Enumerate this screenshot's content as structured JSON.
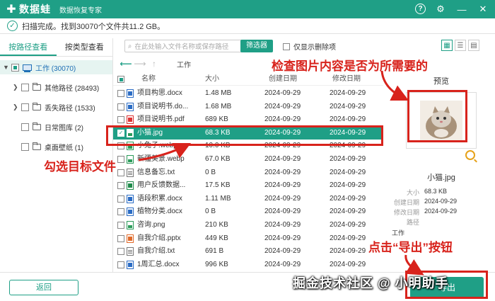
{
  "app": {
    "logo": "数据蛙",
    "subtitle": "数据恢复专家",
    "controls": {
      "help": "?",
      "settings": "⚙",
      "minimize": "—",
      "close": "✕"
    }
  },
  "status": {
    "text": "扫描完成。找到30070个文件共11.2 GB。"
  },
  "left": {
    "tabs": [
      {
        "label": "按路径查看",
        "active": true
      },
      {
        "label": "按类型查看",
        "active": false
      }
    ],
    "tree": [
      {
        "label": "工作 (30070)"
      },
      {
        "label": "其他路径 (28493)"
      },
      {
        "label": "丢失路径 (1533)"
      },
      {
        "label": "日常图库 (2)"
      },
      {
        "label": "桌面壁纸 (1)"
      }
    ]
  },
  "toolbar": {
    "search_placeholder": "在此处输入文件名称或保存路径",
    "filter_label": "筛选器",
    "deleted_only_label": "仅显示删除项"
  },
  "nav": {
    "path": "工作"
  },
  "list": {
    "headers": {
      "name": "名称",
      "size": "大小",
      "created": "创建日期",
      "modified": "修改日期"
    },
    "rows": [
      {
        "icon": "docx",
        "name": "项目构思.docx",
        "size": "1.48 MB",
        "created": "2024-09-29",
        "modified": "2024-09-29"
      },
      {
        "icon": "docx",
        "name": "项目说明书.do...",
        "size": "1.68 MB",
        "created": "2024-09-29",
        "modified": "2024-09-29"
      },
      {
        "icon": "pdf",
        "name": "项目说明书.pdf",
        "size": "689 KB",
        "created": "2024-09-29",
        "modified": "2024-09-29"
      },
      {
        "icon": "image",
        "name": "小猫.jpg",
        "size": "68.3 KB",
        "created": "2024-09-29",
        "modified": "2024-09-29",
        "selected": true
      },
      {
        "icon": "image",
        "name": "小兔子.webp",
        "size": "10.0 KB",
        "created": "2024-09-29",
        "modified": "2024-09-29"
      },
      {
        "icon": "image",
        "name": "新疆美景.webp",
        "size": "67.0 KB",
        "created": "2024-09-29",
        "modified": "2024-09-29"
      },
      {
        "icon": "txt",
        "name": "信息备忘.txt",
        "size": "0 B",
        "created": "2024-09-29",
        "modified": "2024-09-29"
      },
      {
        "icon": "xlsx",
        "name": "用户反馈数据...",
        "size": "17.5 KB",
        "created": "2024-09-29",
        "modified": "2024-09-29"
      },
      {
        "icon": "docx",
        "name": "语段积累.docx",
        "size": "1.11 MB",
        "created": "2024-09-29",
        "modified": "2024-09-29"
      },
      {
        "icon": "docx",
        "name": "植物分类.docx",
        "size": "0 B",
        "created": "2024-09-29",
        "modified": "2024-09-29"
      },
      {
        "icon": "image",
        "name": "咨询.png",
        "size": "210 KB",
        "created": "2024-09-29",
        "modified": "2024-09-29"
      },
      {
        "icon": "pptx",
        "name": "自我介绍.pptx",
        "size": "449 KB",
        "created": "2024-09-29",
        "modified": "2024-09-29"
      },
      {
        "icon": "txt",
        "name": "自我介绍.txt",
        "size": "691 B",
        "created": "2024-09-29",
        "modified": "2024-09-29"
      },
      {
        "icon": "docx",
        "name": "1周汇总.docx",
        "size": "996 KB",
        "created": "2024-09-29",
        "modified": "2024-09-29"
      }
    ]
  },
  "preview": {
    "title": "预览",
    "file_name": "小猫.jpg",
    "meta": [
      {
        "key": "大小",
        "value": "68.3 KB"
      },
      {
        "key": "创建日期",
        "value": "2024-09-29"
      },
      {
        "key": "修改日期",
        "value": "2024-09-29"
      },
      {
        "key": "路径",
        "value": ""
      }
    ],
    "path_value": "工作"
  },
  "annotations": {
    "check_preview": "检查图片内容是否为所需要的",
    "select_file": "勾选目标文件",
    "click_export": "点击“导出”按钮",
    "color": "#d8231c"
  },
  "bottom": {
    "back_label": "返回",
    "export_label": "导出"
  },
  "watermark": "掘金技术社区 @ 小明助手",
  "colors": {
    "accent": "#1f9f86",
    "annotation": "#d8231c"
  }
}
